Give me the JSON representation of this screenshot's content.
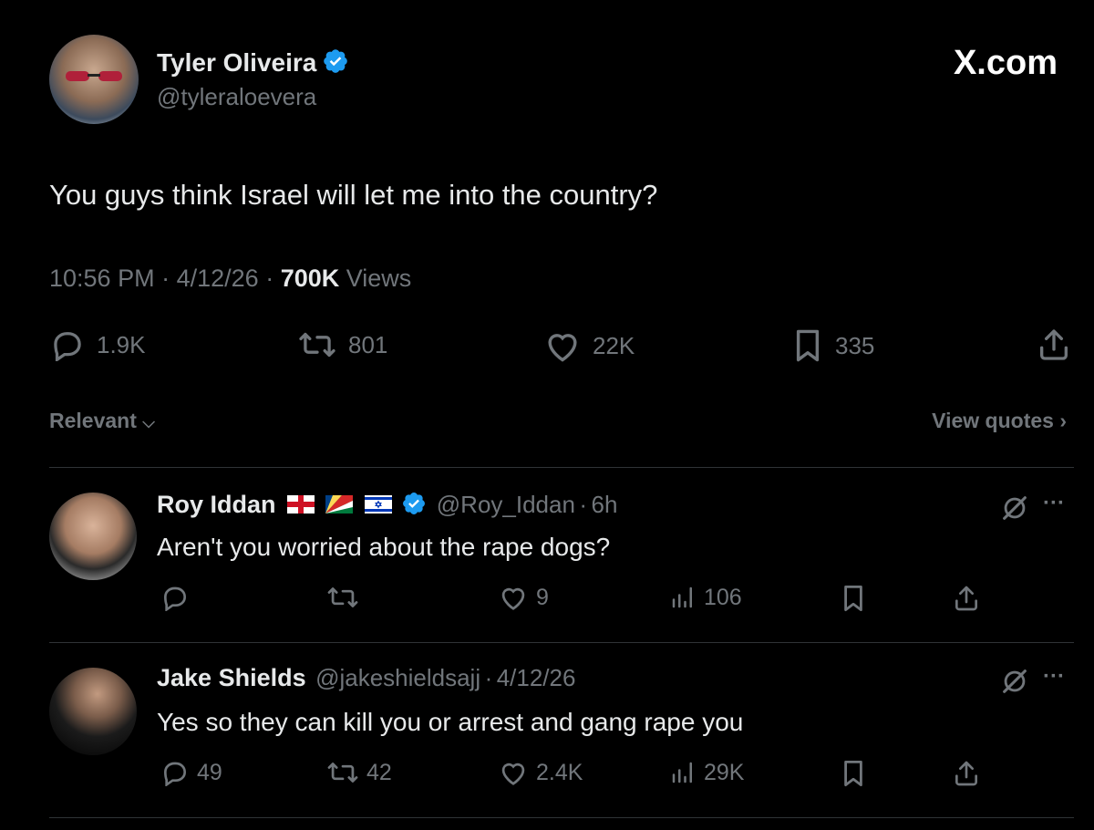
{
  "header": {
    "name": "Tyler Oliveira",
    "handle": "@tyleraloevera",
    "site": "X.com"
  },
  "tweet": {
    "text": "You guys think Israel will let me into the country?",
    "time": "10:56 PM",
    "date": "4/12/26",
    "views_count": "700K",
    "views_label": "Views",
    "replies": "1.9K",
    "reposts": "801",
    "likes": "22K",
    "bookmarks": "335"
  },
  "replies_bar": {
    "sort_label": "Relevant",
    "view_quotes_label": "View quotes"
  },
  "replies": [
    {
      "name": "Roy Iddan",
      "handle": "@Roy_Iddan",
      "time": "6h",
      "text": "Aren't you worried about the rape dogs?",
      "replies": "",
      "reposts": "",
      "likes": "9",
      "views": "106"
    },
    {
      "name": "Jake Shields",
      "handle": "@jakeshieldsajj",
      "time": "4/12/26",
      "text": "Yes so they can kill you or arrest and gang rape you",
      "replies": "49",
      "reposts": "42",
      "likes": "2.4K",
      "views": "29K"
    }
  ],
  "colors": {
    "background": "#000000",
    "text": "#e7e9ea",
    "muted": "#71767b",
    "verified": "#1d9bf0",
    "divider": "#2f3336"
  }
}
